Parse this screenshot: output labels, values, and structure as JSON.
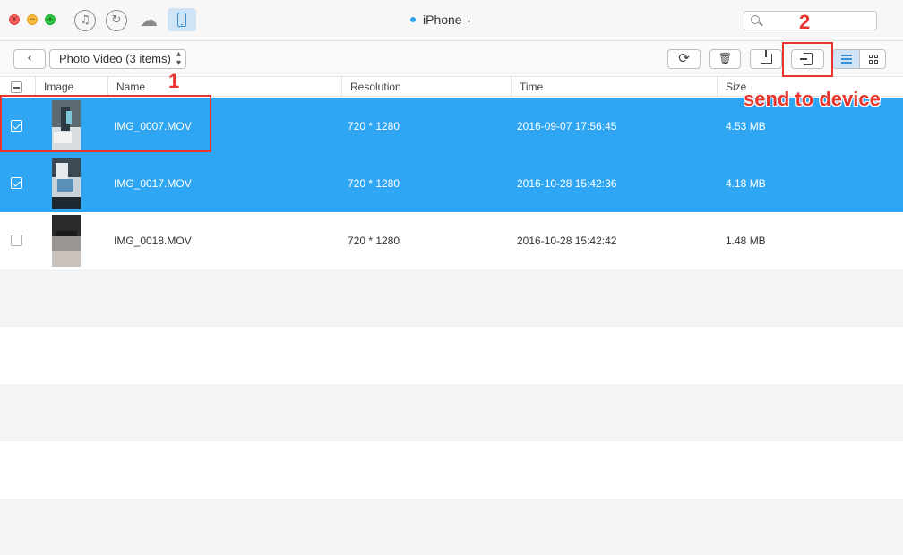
{
  "window": {
    "device_name": "iPhone",
    "icons": [
      "itunes-music-icon",
      "restore-icon",
      "icloud-icon",
      "device-icon"
    ]
  },
  "search": {
    "placeholder": "",
    "value": ""
  },
  "toolbar": {
    "category": "Photo Video (3 items)",
    "buttons": [
      "back",
      "refresh",
      "delete",
      "export-to-computer",
      "send-to-device",
      "list-view",
      "grid-view"
    ]
  },
  "table": {
    "columns": {
      "image": "Image",
      "name": "Name",
      "resolution": "Resolution",
      "time": "Time",
      "size": "Size"
    },
    "rows": [
      {
        "name": "IMG_0007.MOV",
        "resolution": "720 * 1280",
        "time": "2016-09-07 17:56:45",
        "size": "4.53 MB",
        "selected": true
      },
      {
        "name": "IMG_0017.MOV",
        "resolution": "720 * 1280",
        "time": "2016-10-28 15:42:36",
        "size": "4.18 MB",
        "selected": true
      },
      {
        "name": "IMG_0018.MOV",
        "resolution": "720 * 1280",
        "time": "2016-10-28 15:42:42",
        "size": "1.48 MB",
        "selected": false
      }
    ]
  },
  "annotations": {
    "step1": "1",
    "step2": "2",
    "send_label": "send to device",
    "color": "#e8362e"
  },
  "colors": {
    "selection": "#2fa6f4",
    "accent": "#3a8fd8"
  }
}
